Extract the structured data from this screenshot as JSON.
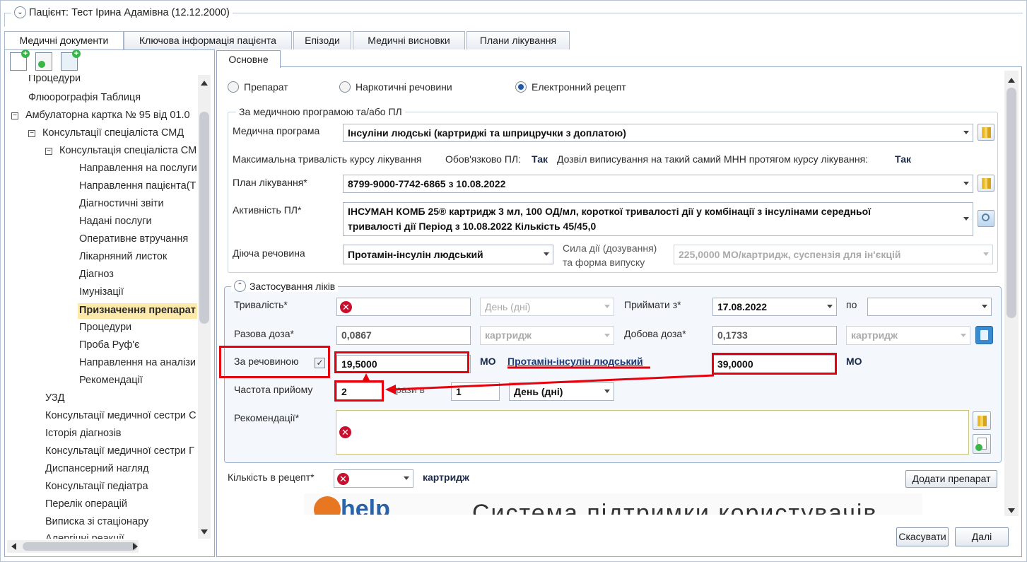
{
  "patient_header": "Пацієнт: Тест Ірина Адамівна (12.12.2000)",
  "tabs": [
    "Медичні документи",
    "Ключова інформація пацієнта",
    "Епізоди",
    "Медичні висновки",
    "Плани лікування"
  ],
  "tree": {
    "items": [
      "Процедури",
      "Флюорографія Таблиця",
      "Амбулаторна картка № 95 від 01.0",
      "Консультації спеціаліста СМД",
      "Консультація спеціаліста СМ",
      "Направлення на послуги",
      "Направлення пацієнта(Т",
      "Діагностичні звіти",
      "Надані послуги",
      "Оперативне втручання",
      "Лікарняний листок",
      "Діагноз",
      "Імунізації",
      "Призначення препарат",
      "Процедури",
      "Проба Руф'є",
      "Направлення на аналізи",
      "Рекомендації",
      "УЗД",
      "Консультації медичної сестри С",
      "Історія діагнозів",
      "Консультації медичної сестри Г",
      "Диспансерний нагляд",
      "Консультації педіатра",
      "Перелік операцій",
      "Виписка зі стаціонару",
      "Алергічні реакції"
    ]
  },
  "subtab": "Основне",
  "radio": {
    "preparat": "Препарат",
    "narcotic": "Наркотичні речовини",
    "erecipe": "Електронний рецепт"
  },
  "program_group": {
    "title": "За медичною програмою та/або ПЛ",
    "program_label": "Медична програма",
    "program_value": "Інсуліни людські (картриджі та шприцручки з доплатою)",
    "max_duration_label": "Максимальна тривалість курсу лікування",
    "mandatory_label": "Обов'язково ПЛ:",
    "mandatory_value": "Так",
    "permit_label": "Дозвіл виписування на такий самий МНН протягом курсу лікування:",
    "permit_value": "Так",
    "plan_label": "План лікування*",
    "plan_value": "8799-9000-7742-6865 з 10.08.2022",
    "activity_label": "Активність ПЛ*",
    "activity_line1": "ІНСУМАН КОМБ 25® картридж 3 мл, 100 ОД/мл, короткої тривалості дії у комбінації з інсулінами середньої",
    "activity_line2": "тривалості дії Період з 10.08.2022 Кількість 45/45,0",
    "substance_label": "Діюча речовина",
    "substance_value": "Протамін-інсулін людський",
    "strength_label1": "Сила дії (дозування)",
    "strength_label2": "та форма випуску",
    "strength_value": "225,0000 МО/картридж, суспензія для ін'єкцій"
  },
  "usage_group": {
    "title": "Застосування ліків",
    "duration_label": "Тривалість*",
    "duration_unit": "День (дні)",
    "take_from_label": "Приймати з*",
    "take_from_value": "17.08.2022",
    "to_label": "по",
    "single_dose_label": "Разова доза*",
    "single_dose_value": "0,0867",
    "single_dose_unit": "картридж",
    "daily_dose_label": "Добова доза*",
    "daily_dose_value": "0,1733",
    "daily_dose_unit": "картридж",
    "by_substance_label": "За речовиною",
    "by_substance_value": "19,5000",
    "by_substance_unit": "МО",
    "substance_link": "Протамін-інсулін людський",
    "daily_substance_value": "39,0000",
    "daily_substance_unit": "МО",
    "frequency_label": "Частота прийому",
    "frequency_value": "2",
    "times_in_label": "рази в",
    "period_value": "1",
    "period_unit": "День (дні)",
    "recommendations_label": "Рекомендації*"
  },
  "quantity_label": "Кількість в рецепт*",
  "quantity_unit": "картридж",
  "add_button": "Додати препарат",
  "banner_text": "Система підтримки користувачів",
  "banner_logo": "help",
  "cancel_button": "Скасувати",
  "next_button": "Далі",
  "colors": {
    "accent": "#1e5aa8",
    "error": "#c8102e",
    "highlight": "#e8000d",
    "selected": "#fde9a9"
  }
}
